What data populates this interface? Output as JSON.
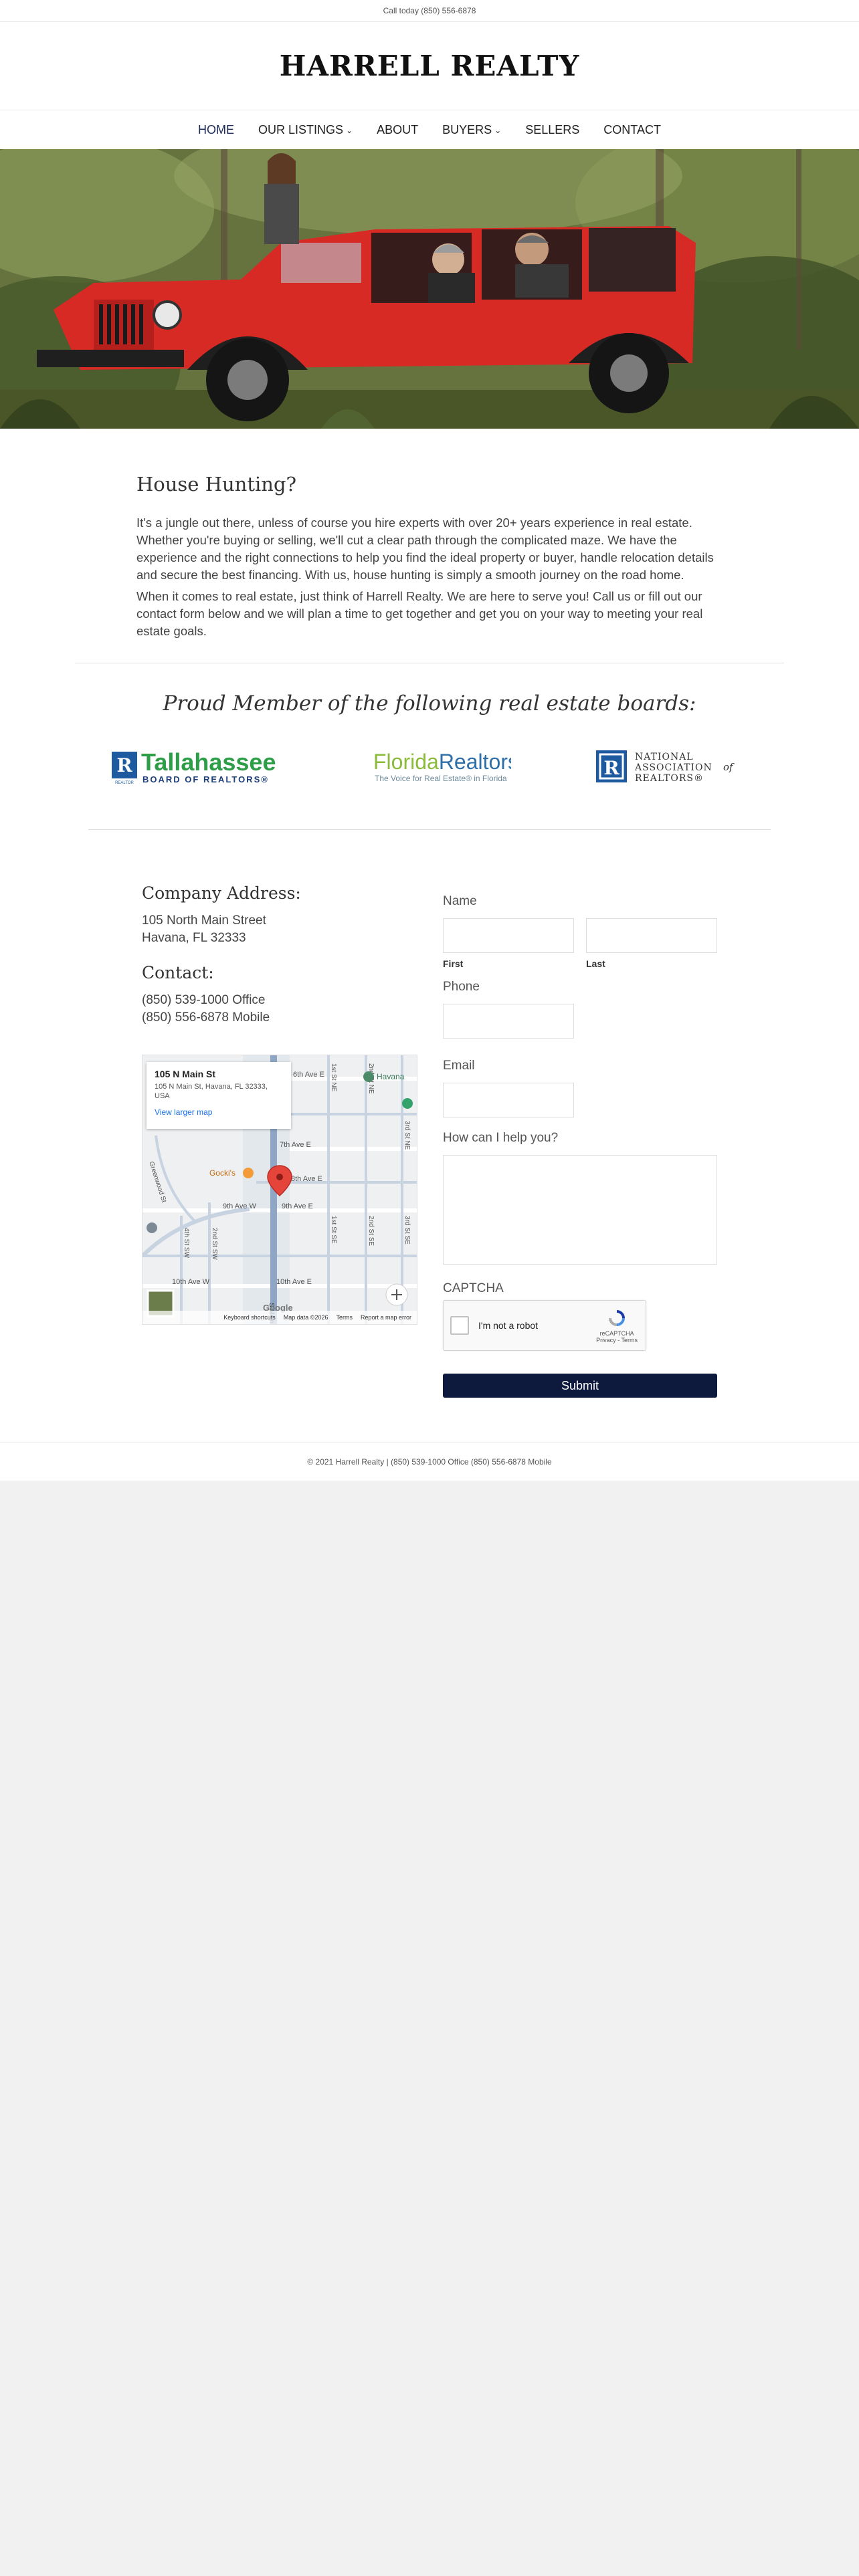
{
  "topbar": {
    "call_text": "Call today (850) 556-6878"
  },
  "brand": {
    "name": "HARRELL REALTY"
  },
  "nav": {
    "items": [
      {
        "label": "HOME"
      },
      {
        "label": "OUR LISTINGS"
      },
      {
        "label": "ABOUT"
      },
      {
        "label": "BUYERS"
      },
      {
        "label": "SELLERS"
      },
      {
        "label": "CONTACT"
      }
    ]
  },
  "intro": {
    "heading": "House Hunting?",
    "p1": "It's a jungle out there, unless of course you hire experts with over 20+ years experience in real estate. Whether you're buying or selling, we'll cut a clear path through the complicated maze. We have the experience and the right connections to help you find the ideal property or buyer, handle relocation details and secure the best financing. With us, house hunting is simply a smooth journey on the road home.",
    "p2": "When it comes to real estate, just think of Harrell Realty. We are here to serve you! Call us or fill out our contact form below and we will plan a time to get together and get you on your way to meeting your real estate goals."
  },
  "boards": {
    "heading": "Proud Member of the following real estate boards:",
    "tallahassee": {
      "name": "Tallahassee",
      "sub": "BOARD OF REALTORS®",
      "realtor": "REALTOR"
    },
    "florida": {
      "name1": "Florida",
      "name2": "Realtors",
      "tagline": "The Voice for Real Estate® in Florida"
    },
    "nar": {
      "line1": "NATIONAL",
      "line2": "ASSOCIATION",
      "of": "of",
      "line3": "REALTORS®"
    }
  },
  "contact": {
    "address_heading": "Company Address:",
    "address_line1": "105 North Main Street",
    "address_line2": "Havana, FL 32333",
    "contact_heading": "Contact:",
    "office": "(850) 539-1000 Office",
    "mobile": "(850) 556-6878 Mobile"
  },
  "map": {
    "place_title": "105 N Main St",
    "place_address": "105 N Main St, Havana, FL 32333, USA",
    "larger_map": "View larger map",
    "streets": [
      "6th Ave E",
      "7th Ave E",
      "8th Ave E",
      "9th Ave W",
      "9th Ave E",
      "10th Ave E",
      "10th Ave W",
      "S Main St",
      "1st St NE",
      "2nd St NE",
      "3rd St NE",
      "1st St SE",
      "2nd St SE",
      "3rd St SE",
      "2nd St SW",
      "4th St SW",
      "Greenwood St"
    ],
    "pois": [
      "Gocki's",
      "Havana"
    ],
    "footer": {
      "shortcuts": "Keyboard shortcuts",
      "data": "Map data ©2026",
      "terms": "Terms",
      "report": "Report a map error"
    },
    "brand_letters": "Google"
  },
  "form": {
    "name_label": "Name",
    "first_label": "First",
    "last_label": "Last",
    "phone_label": "Phone",
    "email_label": "Email",
    "help_label": "How can I help you?",
    "captcha_label": "CAPTCHA",
    "captcha_text": "I'm not a robot",
    "captcha_brand": "reCAPTCHA",
    "captcha_links": "Privacy - Terms",
    "submit_label": "Submit"
  },
  "footer": {
    "text": "© 2021 Harrell Realty | (850) 539-1000 Office (850) 556-6878 Mobile"
  },
  "colors": {
    "nav_active": "#1e2a5a",
    "submit_bg": "#0d1a3d",
    "tallahassee_green": "#2e9d48",
    "realtor_blue": "#1d5aa0"
  }
}
